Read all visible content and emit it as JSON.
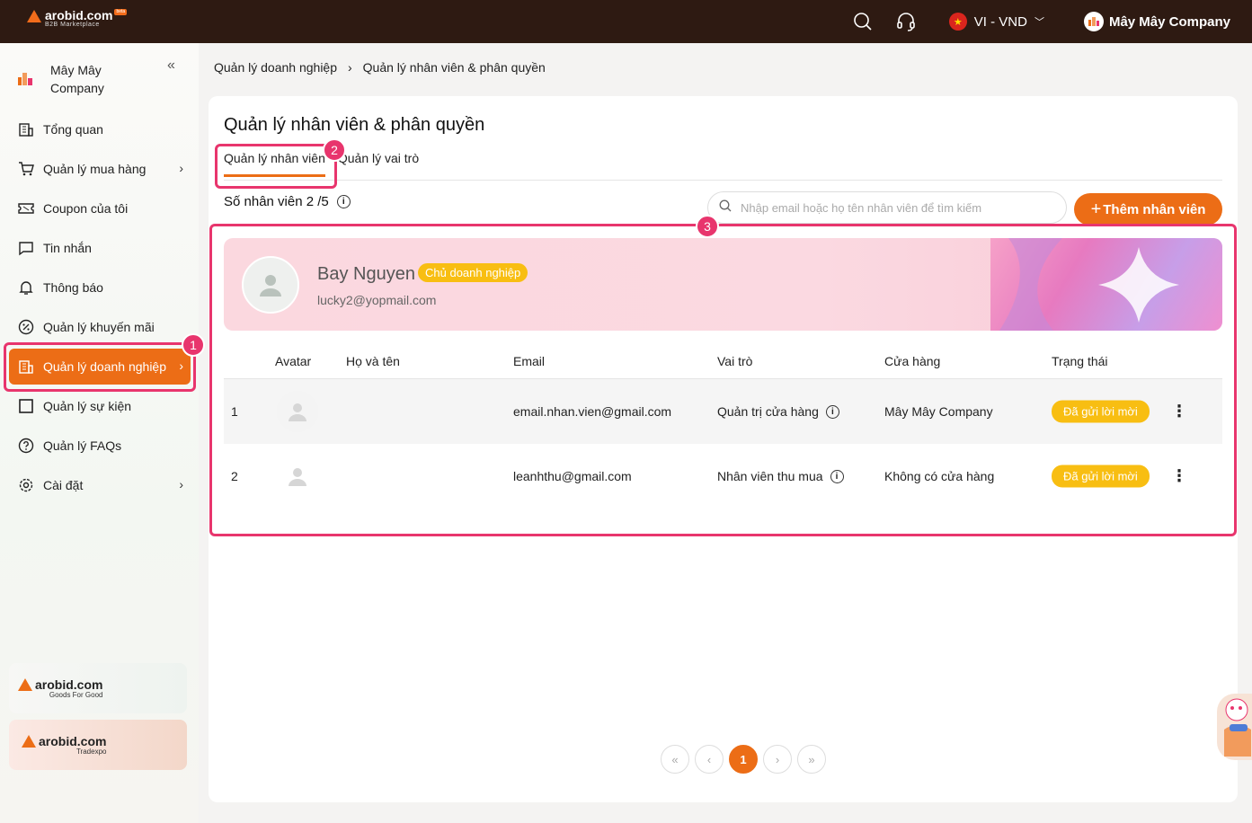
{
  "header": {
    "logo_name": "arobid.com",
    "logo_sub": "B2B Marketplace",
    "logo_badge": "beta",
    "language": "VI - VND",
    "company": "Mây Mây Company"
  },
  "sidebar": {
    "company_name": "Mây Mây Company",
    "items": [
      {
        "label": "Tổng quan",
        "icon": "building-icon"
      },
      {
        "label": "Quản lý mua hàng",
        "icon": "cart-icon",
        "chevron": true
      },
      {
        "label": "Coupon của tôi",
        "icon": "coupon-icon"
      },
      {
        "label": "Tin nhắn",
        "icon": "message-icon"
      },
      {
        "label": "Thông báo",
        "icon": "bell-icon"
      },
      {
        "label": "Quản lý khuyến mãi",
        "icon": "percent-icon"
      },
      {
        "label": "Quản lý doanh nghiệp",
        "icon": "enterprise-icon",
        "chevron": true,
        "active": true
      },
      {
        "label": "Quản lý sự kiện",
        "icon": "event-icon"
      },
      {
        "label": "Quản lý FAQs",
        "icon": "question-icon"
      },
      {
        "label": "Cài đặt",
        "icon": "settings-icon",
        "chevron": true
      }
    ],
    "promo1": {
      "title": "arobid.com",
      "sub": "Goods For Good"
    },
    "promo2": {
      "title": "arobid.com",
      "sub": "Tradexpo"
    }
  },
  "breadcrumb": [
    "Quản lý doanh nghiệp",
    "Quản lý nhân viên & phân quyền"
  ],
  "page_title": "Quản lý nhân viên & phân quyền",
  "tabs": [
    "Quản lý nhân viên",
    "Quản lý vai trò"
  ],
  "employee_count": "Số nhân viên 2 /5",
  "search": {
    "placeholder": "Nhập email hoặc họ tên nhân viên để tìm kiếm"
  },
  "add_button": "Thêm nhân viên",
  "owner": {
    "name": "Bay Nguyen",
    "tag": "Chủ doanh nghiệp",
    "email": "lucky2@yopmail.com"
  },
  "table": {
    "headers": [
      "Avatar",
      "Họ và tên",
      "Email",
      "Vai trò",
      "Cửa hàng",
      "Trạng thái"
    ],
    "rows": [
      {
        "no": "1",
        "name": "",
        "email": "email.nhan.vien@gmail.com",
        "role": "Quản trị cửa hàng",
        "store": "Mây Mây Company",
        "status": "Đã gửi lời mời"
      },
      {
        "no": "2",
        "name": "",
        "email": "leanhthu@gmail.com",
        "role": "Nhân viên thu mua",
        "store": "Không có cửa hàng",
        "status": "Đã gửi lời mời"
      }
    ]
  },
  "pagination": {
    "current": "1"
  },
  "annotations": [
    "1",
    "2",
    "3"
  ],
  "colors": {
    "accent": "#ec6d16",
    "highlight": "#e8356d",
    "badge": "#f8be12",
    "topbar": "#2e1a12"
  }
}
